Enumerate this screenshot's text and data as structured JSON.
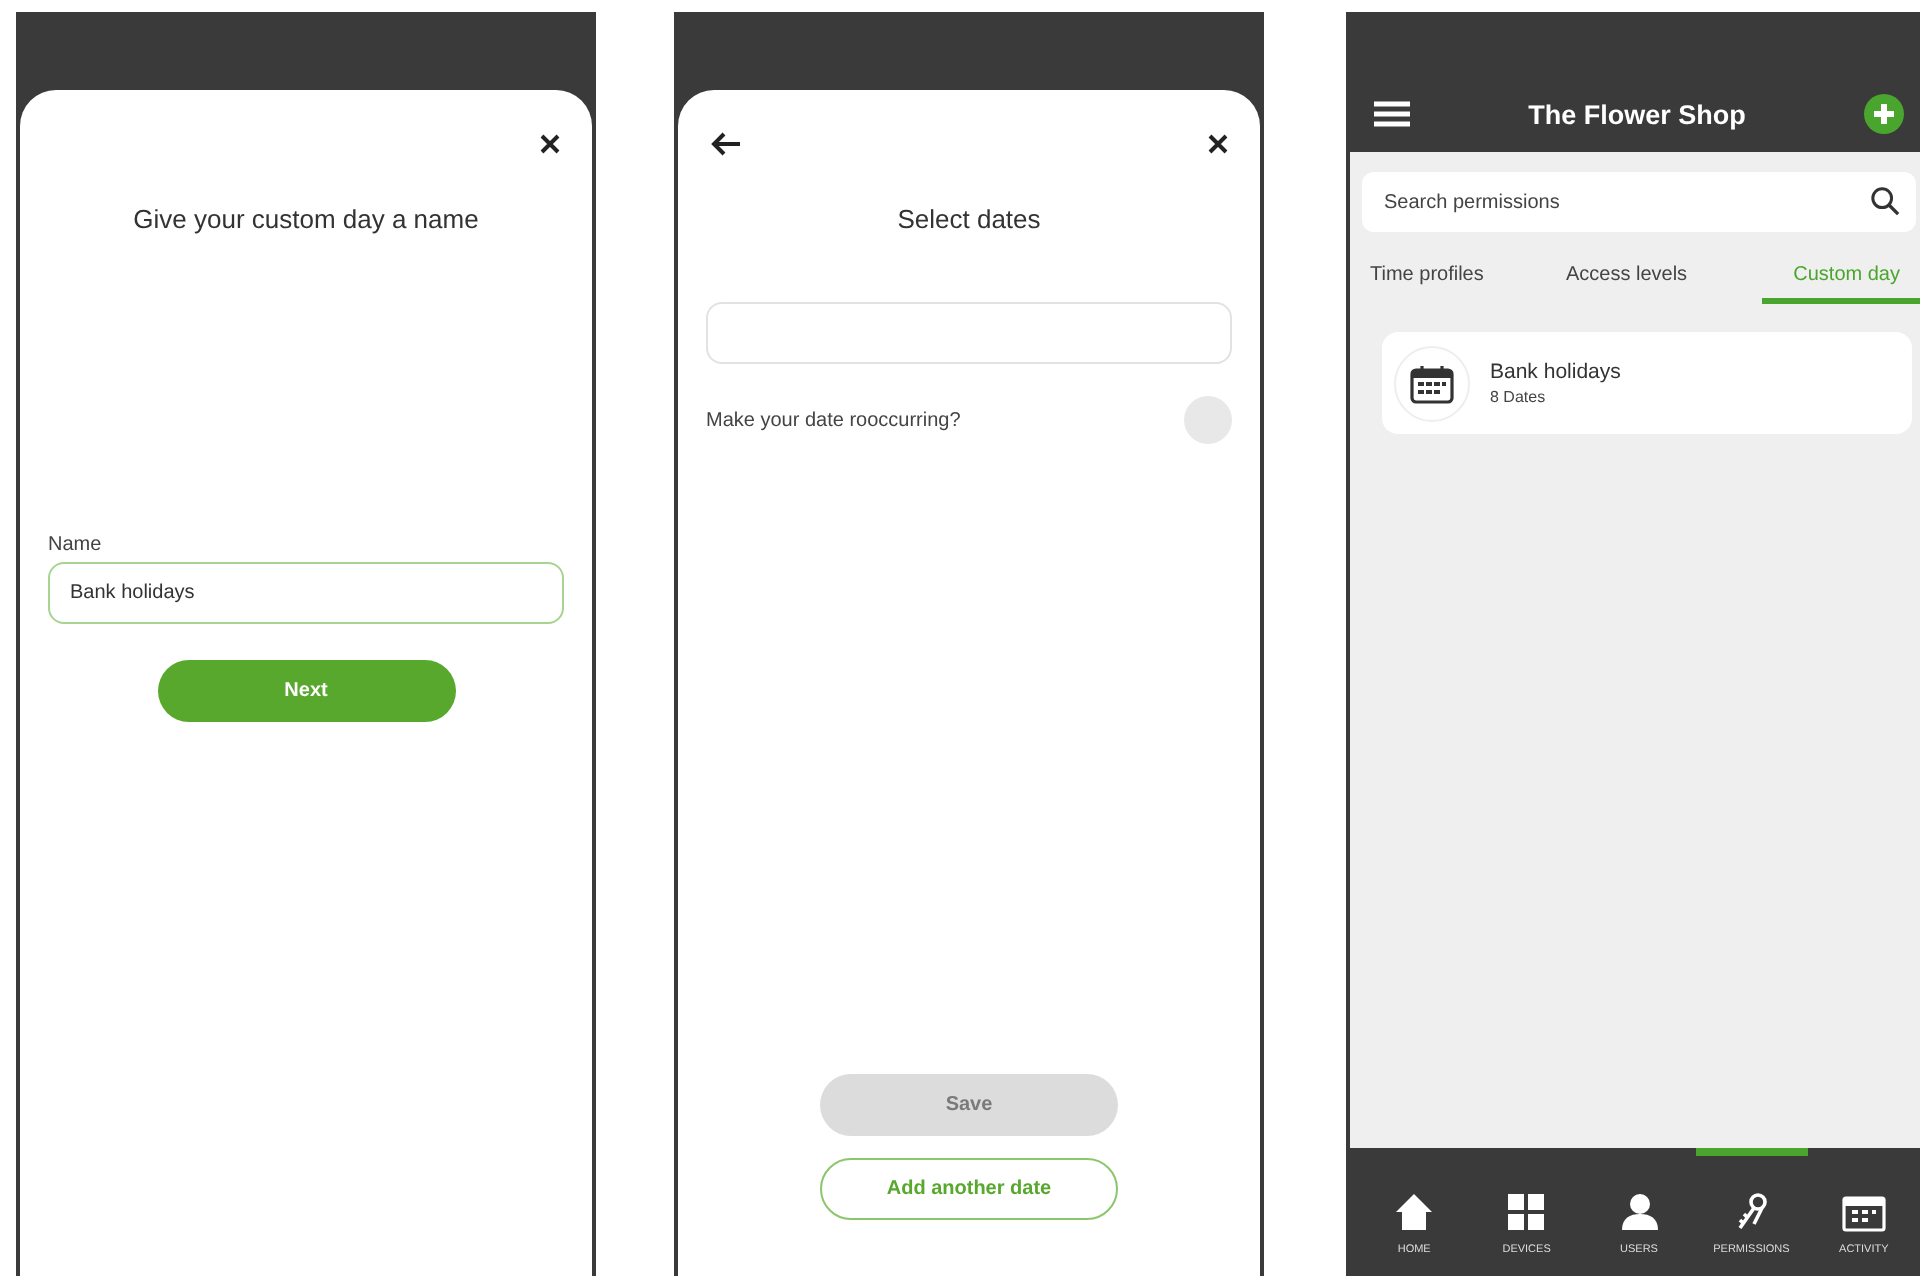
{
  "name_screen": {
    "title": "Give your custom day a name",
    "name_field": {
      "label": "Name",
      "value": "Bank holidays"
    },
    "next_button": "Next"
  },
  "dates_screen": {
    "title": "Select dates",
    "recurring": {
      "label": "Make your date rooccurring?",
      "on": false
    },
    "save_button": {
      "label": "Save",
      "disabled": true
    },
    "add_button": "Add another date"
  },
  "list_screen": {
    "title": "The Flower Shop",
    "search": {
      "placeholder": "Search permissions"
    },
    "tabs": [
      {
        "label": "Time profiles",
        "selected": false
      },
      {
        "label": "Access levels",
        "selected": false
      },
      {
        "label": "Custom day",
        "selected": true
      }
    ],
    "items": [
      {
        "name": "Bank holidays",
        "detail": "8 Dates"
      }
    ],
    "nav": [
      {
        "label": "HOME",
        "selected": false
      },
      {
        "label": "DEVICES",
        "selected": false
      },
      {
        "label": "USERS",
        "selected": false
      },
      {
        "label": "PERMISSIONS",
        "selected": true
      },
      {
        "label": "ACTIVITY",
        "selected": false
      }
    ]
  }
}
